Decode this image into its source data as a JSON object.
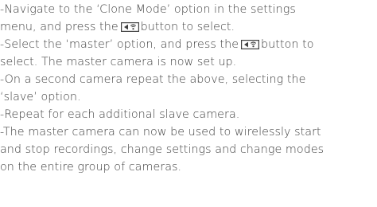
{
  "instructions": {
    "step1": {
      "part1": "-Navigate to the ‘Clone Mode’ option in the settings",
      "part2": "menu, and press the",
      "part3": "button to select."
    },
    "step2": {
      "part1": "-Select the ‘master’ option, and press the",
      "part2": "button to",
      "part3": "select. The master camera is now set up."
    },
    "step3": {
      "part1": "-On a second camera repeat the above, selecting the",
      "part2": "‘slave’ option."
    },
    "step4": {
      "part1": "-Repeat for each additional slave camera."
    },
    "step5": {
      "part1": "-The master camera can now be used to wirelessly start",
      "part2": "and stop recordings, change settings and change modes",
      "part3": "on the entire group of cameras."
    }
  },
  "icons": {
    "select_button": "left-triangle-wifi-button-icon"
  }
}
